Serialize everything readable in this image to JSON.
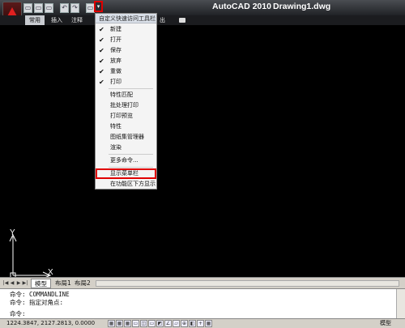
{
  "titlebar": {
    "app_name": "AutoCAD 2010",
    "file_name": "Drawing1.dwg",
    "qat_icons": [
      "new-icon",
      "open-icon",
      "save-icon",
      "undo-icon",
      "redo-icon",
      "plot-icon"
    ],
    "qat_glyphs": [
      "▭",
      "▭",
      "▭",
      "↶",
      "↷",
      "▭"
    ],
    "qat_dropdown_glyph": "▾"
  },
  "ribbon": {
    "tabs": [
      "常用",
      "插入",
      "注释",
      "出"
    ],
    "active_tab": "常用"
  },
  "qat_menu": {
    "header": "自定义快速访问工具栏",
    "items": [
      {
        "label": "新建",
        "checked": true
      },
      {
        "label": "打开",
        "checked": true
      },
      {
        "label": "保存",
        "checked": true
      },
      {
        "label": "放弃",
        "checked": true
      },
      {
        "label": "重做",
        "checked": true
      },
      {
        "label": "打印",
        "checked": true
      },
      {
        "label": "特性匹配",
        "checked": false
      },
      {
        "label": "批处理打印",
        "checked": false
      },
      {
        "label": "打印预览",
        "checked": false
      },
      {
        "label": "特性",
        "checked": false
      },
      {
        "label": "图纸集管理器",
        "checked": false
      },
      {
        "label": "渲染",
        "checked": false
      },
      {
        "label": "更多命令...",
        "checked": false
      },
      {
        "label": "显示菜单栏",
        "checked": false
      },
      {
        "label": "在功能区下方显示",
        "checked": false
      }
    ],
    "check_glyph": "✔"
  },
  "ucs": {
    "x_label": "X",
    "y_label": "Y"
  },
  "layout_tabs": {
    "nav": [
      "|◀",
      "◀",
      "▶",
      "▶|"
    ],
    "tabs": [
      "模型",
      "布局1",
      "布局2"
    ]
  },
  "command": {
    "lines": [
      "命令: COMMANDLINE",
      "命令: 指定对角点:",
      "命令:"
    ]
  },
  "statusbar": {
    "coordinates": "1224.3847, 2127.2813, 0.0000",
    "model": "模型",
    "toggle_glyphs": [
      "▦",
      "▦",
      "▦",
      "▭",
      "◫",
      "▭",
      "◩",
      "∠",
      "▱",
      "⊕",
      "◧",
      "+",
      "▦"
    ]
  }
}
